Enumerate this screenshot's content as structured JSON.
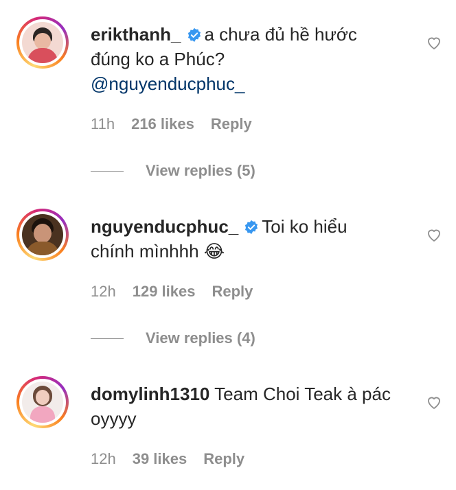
{
  "comments": [
    {
      "username": "erikthanh_",
      "verified": true,
      "text": "a chưa đủ hề hước đúng ko a Phúc?",
      "mention": "@nguyenducphuc_",
      "time": "11h",
      "likes": "216 likes",
      "reply_label": "Reply",
      "view_replies": "View replies (5)"
    },
    {
      "username": "nguyenducphuc_",
      "verified": true,
      "text": "Toi ko hiểu chính mìnhhh 😂",
      "time": "12h",
      "likes": "129 likes",
      "reply_label": "Reply",
      "view_replies": "View replies (4)"
    },
    {
      "username": "domylinh1310",
      "verified": false,
      "text": "Team Choi Teak à pác oyyyy",
      "time": "12h",
      "likes": "39 likes",
      "reply_label": "Reply"
    }
  ],
  "icons": {
    "verified": "verified-badge-icon",
    "like": "heart-outline-icon"
  },
  "colors": {
    "verified_blue": "#3897f0",
    "mention": "#003569",
    "meta_gray": "#8e8e8e"
  }
}
